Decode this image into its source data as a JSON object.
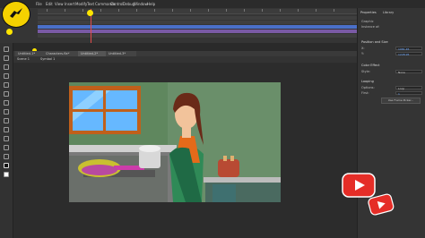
{
  "menu": {
    "items": [
      "File",
      "Edit",
      "View",
      "Insert",
      "Modify",
      "Text",
      "Commands",
      "Control",
      "Debug",
      "Window",
      "Help"
    ]
  },
  "document_tabs": [
    "Untitled-1*",
    "Characters.fla*",
    "Untitled-2*",
    "Untitled-3*"
  ],
  "edit_bar": {
    "scene": "Scene 1",
    "symbol": "Symbol 1"
  },
  "properties": {
    "tab_properties": "Properties",
    "tab_library": "Library",
    "object_type": "Graphic",
    "instance_of": "Instance of:",
    "section_position": "Position and Size",
    "x_label": "X:",
    "x_value": "1081.45",
    "y_label": "Y:",
    "y_value": "1228.95",
    "w_label": "W:",
    "h_label": "H:",
    "section_color": "Color Effect",
    "style_label": "Style:",
    "style_value": "None",
    "section_looping": "Looping",
    "options_label": "Options:",
    "options_value": "Loop",
    "first_label": "First:",
    "first_value": "1",
    "frame_picker": "Use Frame Picker..."
  },
  "colors": {
    "accent_blue": "#4a6fc9",
    "timeline_purple": "#7a5aa5",
    "youtube_red": "#e52d27",
    "logo_yellow": "#f5d100"
  }
}
